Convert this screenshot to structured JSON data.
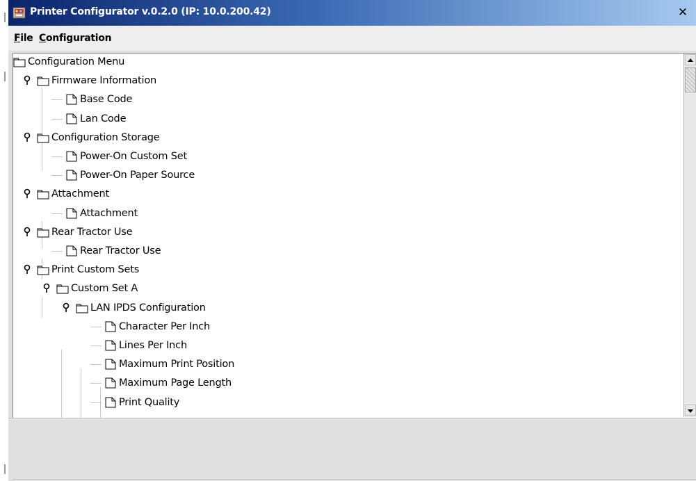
{
  "window": {
    "title": "Printer Configurator v.0.2.0 (IP: 10.0.200.42)",
    "close_label": "✕"
  },
  "menu": {
    "file": {
      "mnemonic": "F",
      "rest": "ile"
    },
    "configuration": {
      "mnemonic": "C",
      "rest": "onfiguration"
    }
  },
  "tree": {
    "root": {
      "label": "Configuration Menu",
      "icon": "folder-icon"
    },
    "nodes": [
      {
        "label": "Firmware Information",
        "icon": "folder-icon",
        "expanded": true
      },
      {
        "label": "Base Code",
        "icon": "document-icon"
      },
      {
        "label": "Lan Code",
        "icon": "document-icon"
      },
      {
        "label": "Configuration Storage",
        "icon": "folder-icon",
        "expanded": true
      },
      {
        "label": "Power-On Custom Set",
        "icon": "document-icon"
      },
      {
        "label": "Power-On Paper Source",
        "icon": "document-icon"
      },
      {
        "label": "Attachment",
        "icon": "folder-icon",
        "expanded": true
      },
      {
        "label": "Attachment",
        "icon": "document-icon"
      },
      {
        "label": "Rear Tractor Use",
        "icon": "folder-icon",
        "expanded": true
      },
      {
        "label": "Rear Tractor Use",
        "icon": "document-icon"
      },
      {
        "label": "Print Custom Sets",
        "icon": "folder-icon",
        "expanded": true
      },
      {
        "label": "Custom Set A",
        "icon": "folder-icon",
        "expanded": true
      },
      {
        "label": "LAN IPDS Configuration",
        "icon": "folder-icon",
        "expanded": true
      },
      {
        "label": "Character Per Inch",
        "icon": "document-icon"
      },
      {
        "label": "Lines Per Inch",
        "icon": "document-icon"
      },
      {
        "label": "Maximum Print Position",
        "icon": "document-icon"
      },
      {
        "label": "Maximum Page Length",
        "icon": "document-icon"
      },
      {
        "label": "Print Quality",
        "icon": "document-icon"
      }
    ]
  },
  "colors": {
    "titlebar_start": "#0a246a",
    "titlebar_end": "#a6caf0",
    "panel_bg": "#ffffff",
    "window_bg": "#e0e0e0"
  }
}
